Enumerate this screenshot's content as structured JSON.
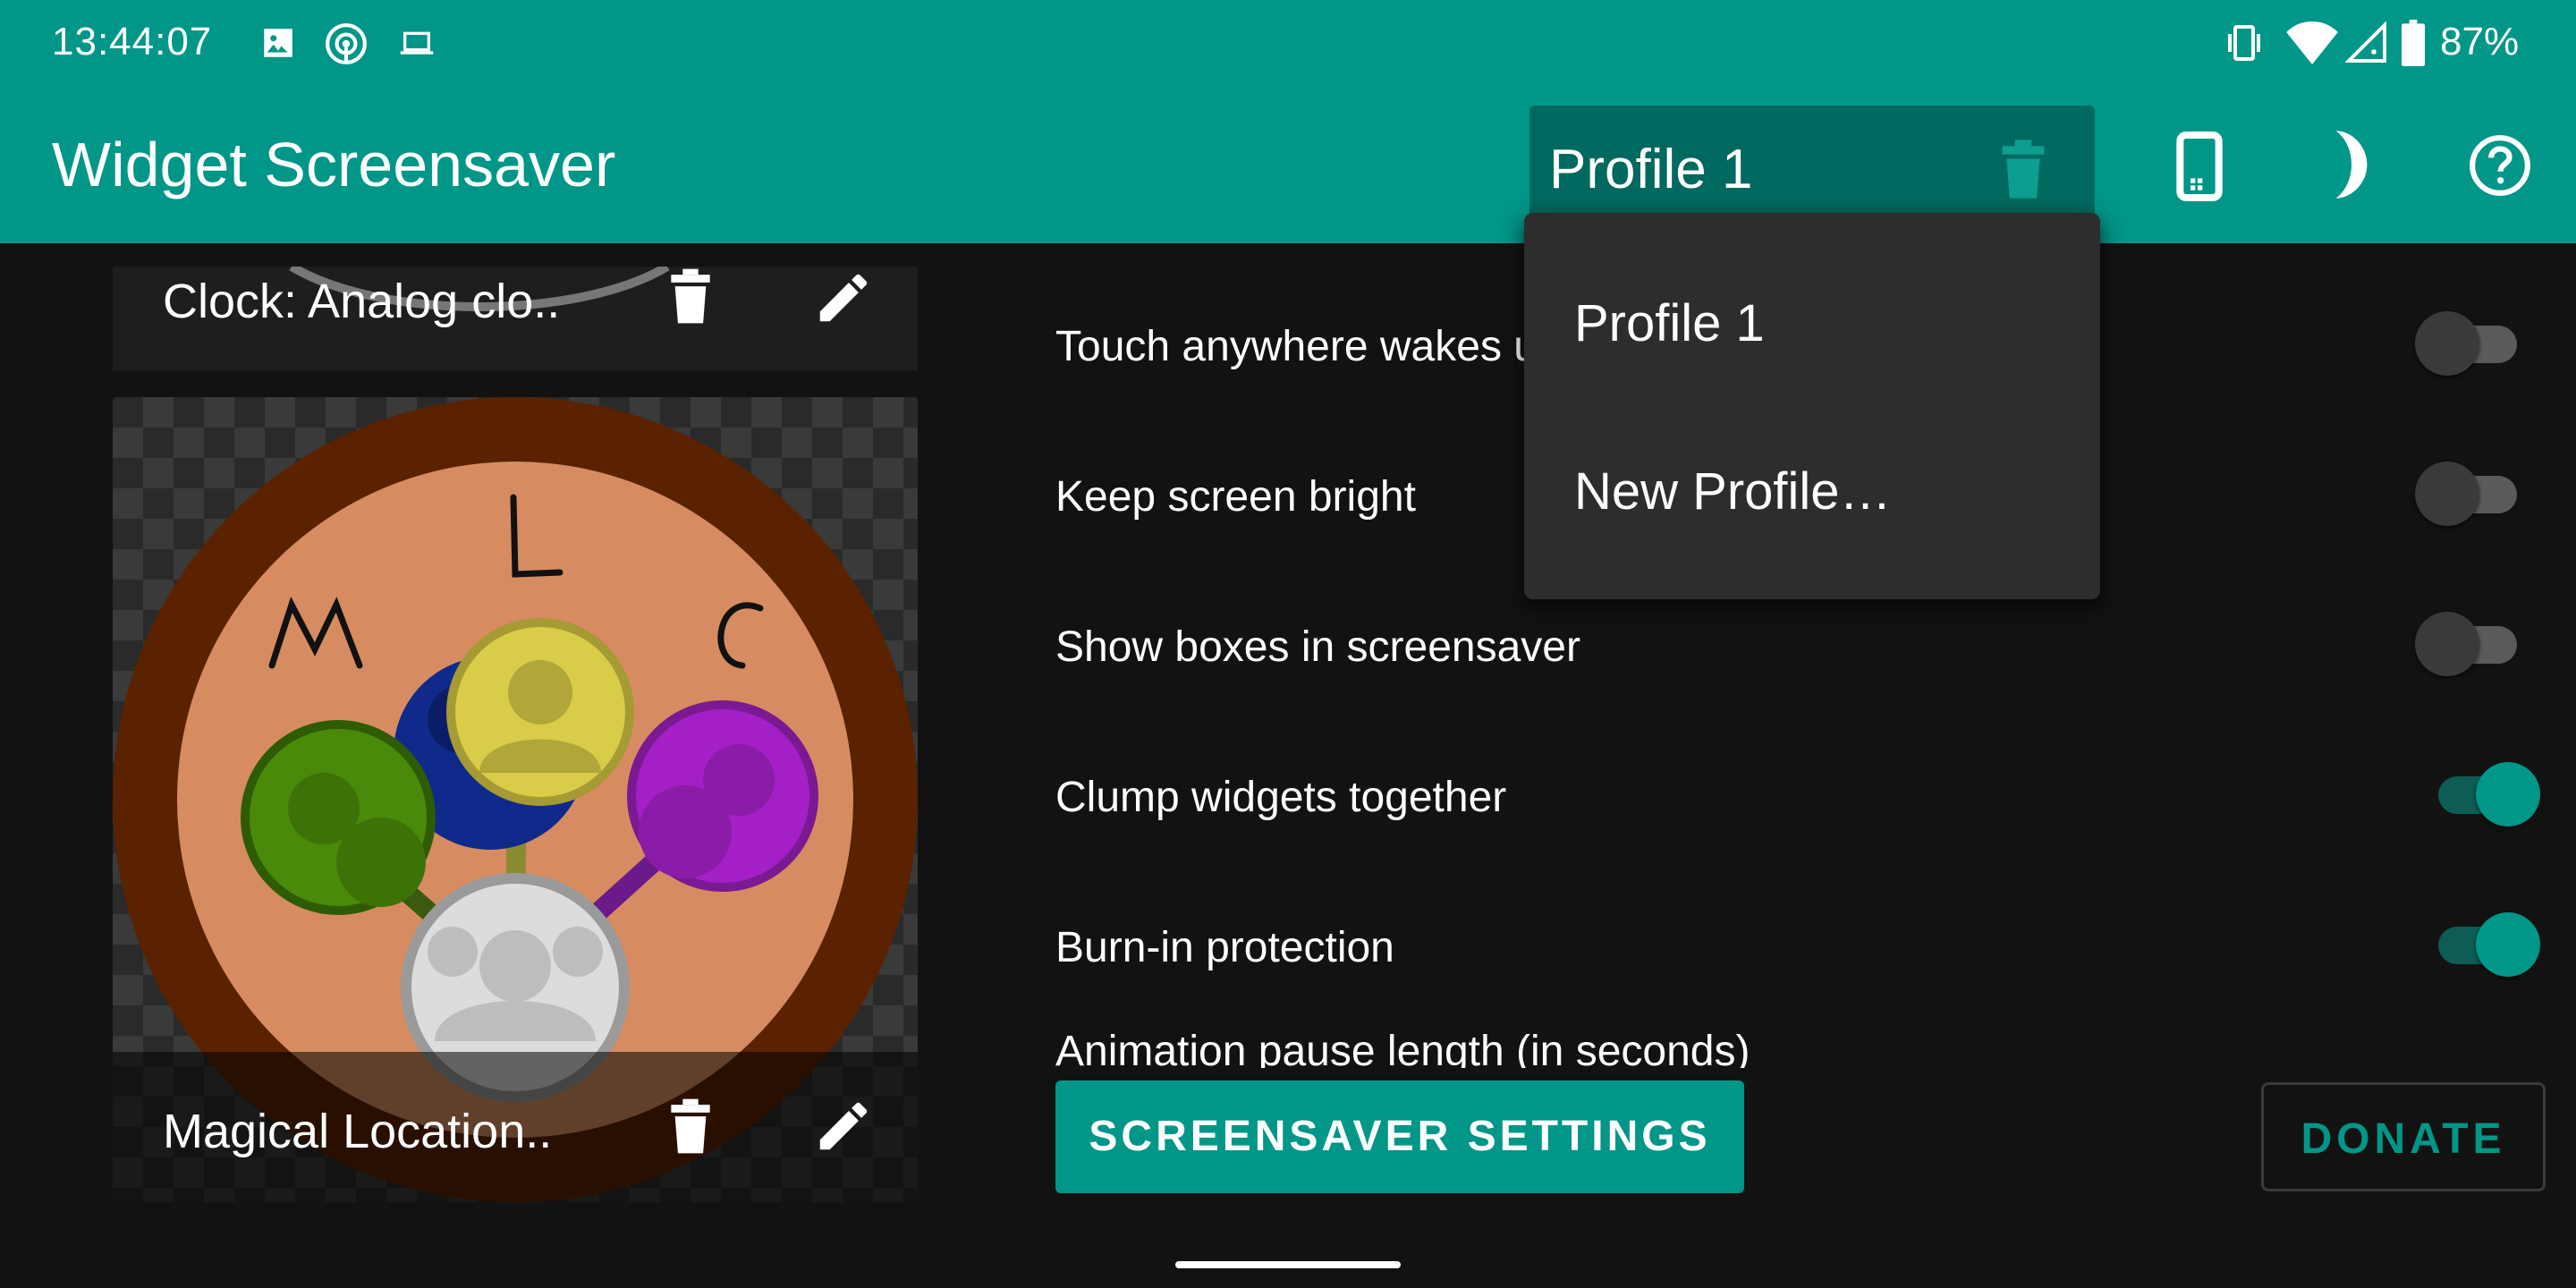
{
  "status_bar": {
    "time": "13:44:07",
    "battery": "87%",
    "icons": [
      "image-icon",
      "hotspot-icon",
      "laptop-icon",
      "vibrate-icon",
      "wifi-icon",
      "signal-icon",
      "battery-icon"
    ]
  },
  "app_bar": {
    "title": "Widget Screensaver",
    "profile_selected": "Profile 1",
    "actions": [
      "phone-icon",
      "moon-icon",
      "help-icon"
    ]
  },
  "profile_menu": {
    "items": [
      "Profile 1",
      "New Profile…"
    ]
  },
  "widgets": [
    {
      "caption": "Clock: Analog clo..",
      "actions": [
        "trash-icon",
        "edit-icon"
      ]
    },
    {
      "caption": "Magical Location..",
      "actions": [
        "trash-icon",
        "edit-icon"
      ],
      "logo_text": "MLC"
    }
  ],
  "settings": [
    {
      "label": "Touch anywhere wakes up",
      "on": false
    },
    {
      "label": "Keep screen bright",
      "on": false
    },
    {
      "label": "Show boxes in screensaver",
      "on": false
    },
    {
      "label": "Clump widgets together",
      "on": true
    },
    {
      "label": "Burn-in protection",
      "on": true
    },
    {
      "label": "Animation pause length (in seconds)"
    }
  ],
  "buttons": {
    "screensaver_settings": "SCREENSAVER SETTINGS",
    "donate": "DONATE"
  },
  "colors": {
    "primary": "#009688",
    "primary_dark": "#00695f",
    "background": "#121212",
    "menu": "#2d2d2d"
  }
}
